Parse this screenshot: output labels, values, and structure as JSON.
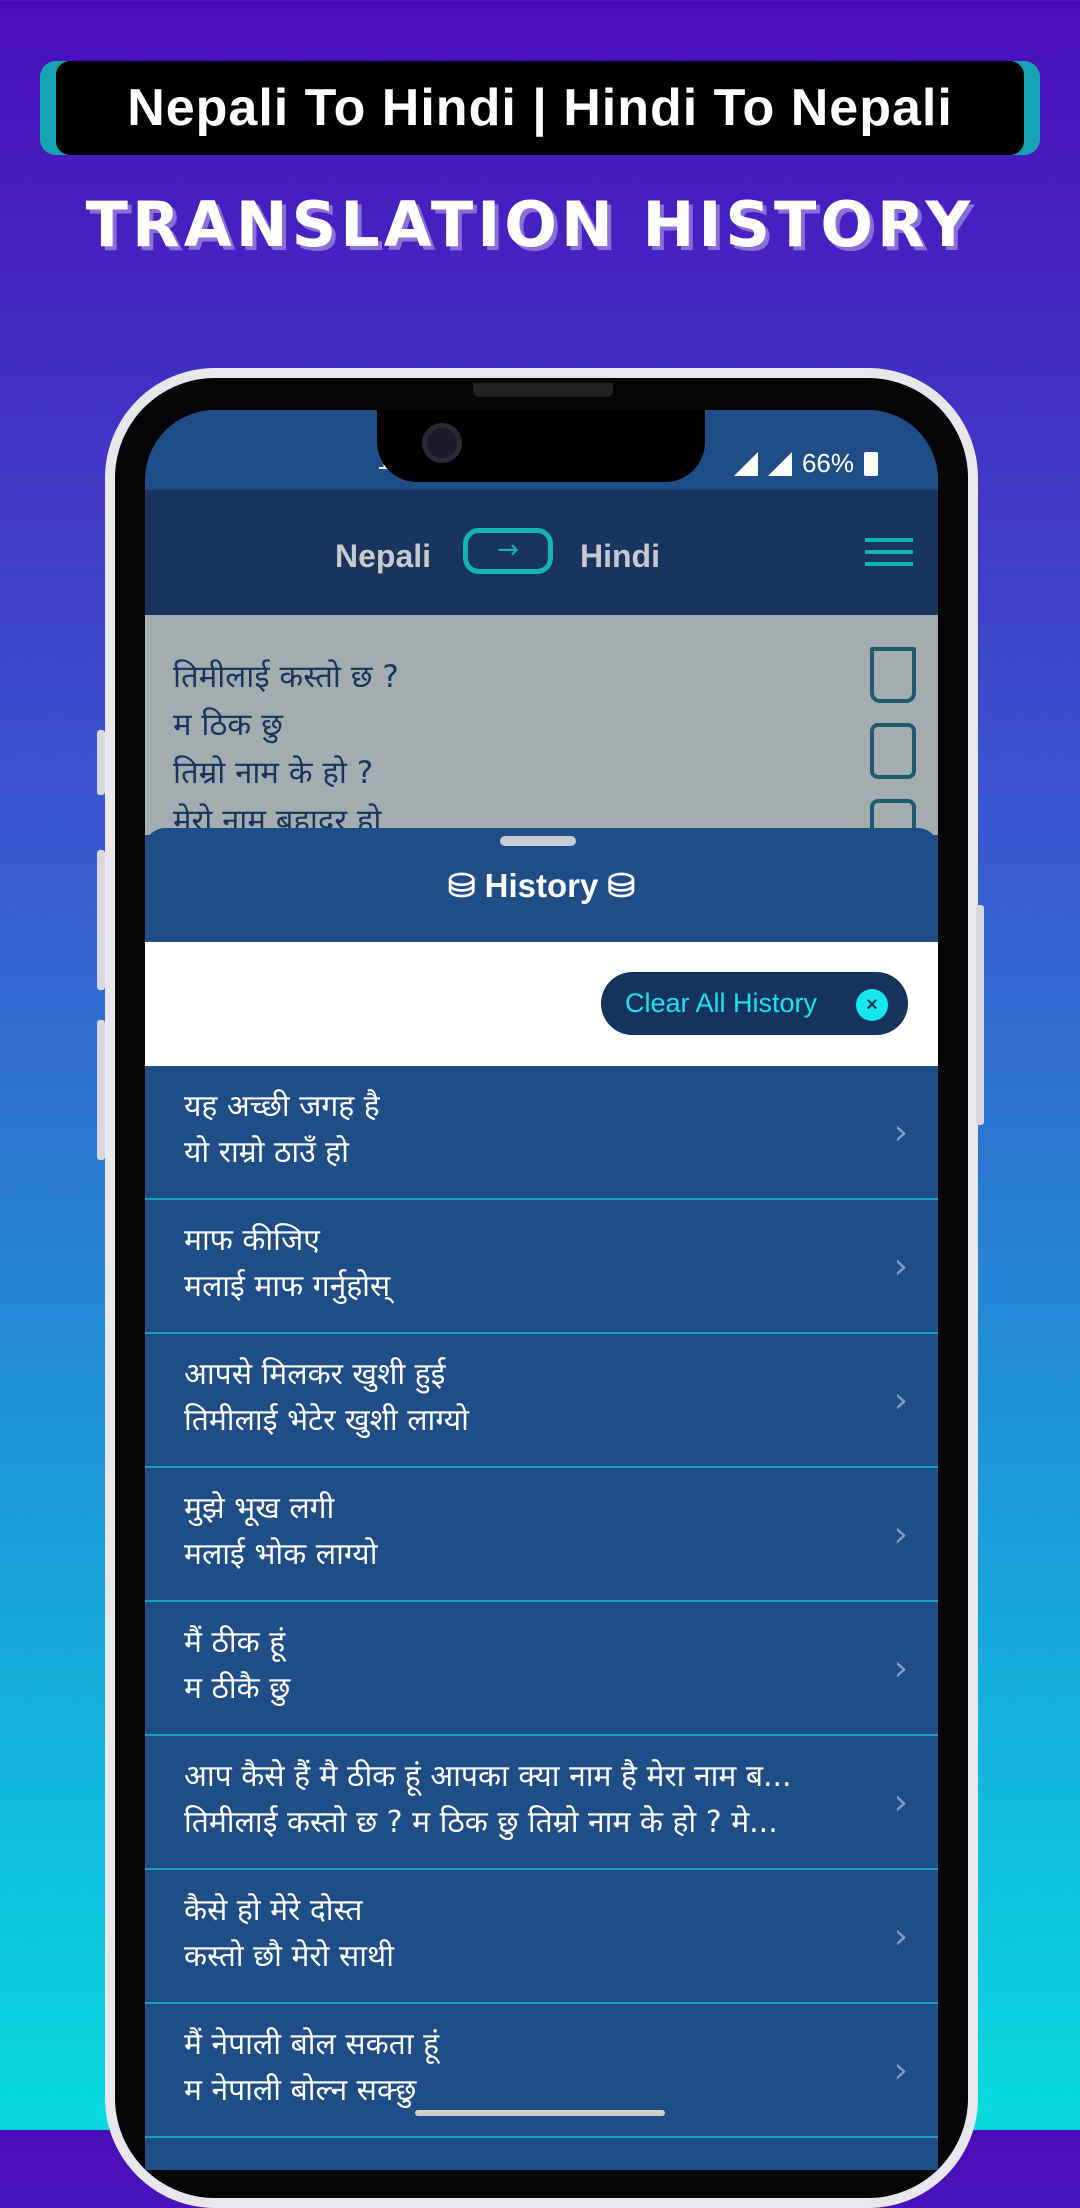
{
  "banner": {
    "title": "Nepali To Hindi | Hindi To Nepali",
    "headline": "TRANSLATION HISTORY"
  },
  "status": {
    "time": "1",
    "battery": "66%"
  },
  "appbar": {
    "source_lang": "Nepali",
    "target_lang": "Hindi",
    "swap_icon": "arrow-right-icon",
    "menu_icon": "hamburger-icon"
  },
  "input": {
    "lines": [
      "तिमीलाई कस्तो छ ?",
      "म ठिक छु",
      "तिम्रो नाम के हो ?",
      "मेरो नाम बहादर हो"
    ]
  },
  "sheet": {
    "title": "History",
    "clear_label": "Clear All History",
    "clear_icon": "×"
  },
  "history": [
    {
      "hindi": "यह अच्छी जगह है",
      "nepali": "यो राम्रो ठाउँ हो"
    },
    {
      "hindi": "माफ कीजिए",
      "nepali": "मलाई माफ गर्नुहोस्"
    },
    {
      "hindi": "आपसे मिलकर खुशी हुई",
      "nepali": "तिमीलाई भेटेर खुशी लाग्यो"
    },
    {
      "hindi": "मुझे भूख लगी",
      "nepali": "मलाई भोक लाग्यो"
    },
    {
      "hindi": "मैं ठीक हूं",
      "nepali": "म ठीकै छु"
    },
    {
      "hindi": "आप कैसे हैं मै ठीक हूं आपका क्या नाम है मेरा नाम ब...",
      "nepali": "तिमीलाई कस्तो छ ? म ठिक छु तिम्रो नाम के हो ? मे..."
    },
    {
      "hindi": "कैसे हो मेरे दोस्त",
      "nepali": "कस्तो छौ मेरो साथी"
    },
    {
      "hindi": "मैं नेपाली बोल सकता हूं",
      "nepali": "म नेपाली बोल्न सक्छु"
    }
  ],
  "colors": {
    "appbar": "#17355e",
    "sheet": "#1f4e87",
    "accent": "#18e6ee"
  }
}
